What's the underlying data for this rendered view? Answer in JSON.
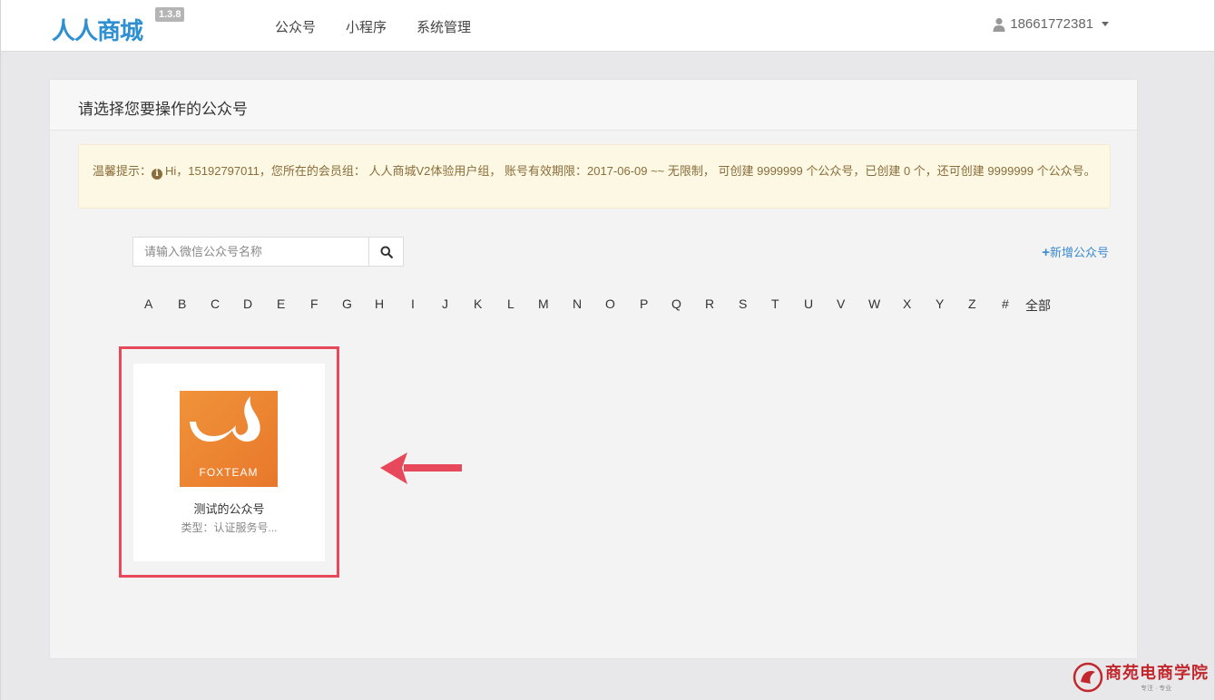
{
  "navbar": {
    "logo_text": "人人商城",
    "version": "1.3.8",
    "items": [
      "公众号",
      "小程序",
      "系统管理"
    ],
    "user": "18661772381"
  },
  "panel": {
    "title": "请选择您要操作的公众号",
    "alert_prefix": "温馨提示：",
    "alert_text": "Hi，15192797011，您所在的会员组： 人人商城V2体验用户组， 账号有效期限：2017-06-09 ~~ 无限制， 可创建 9999999 个公众号，已创建 0 个，还可创建 9999999 个公众号。"
  },
  "search": {
    "placeholder": "请输入微信公众号名称"
  },
  "add_account": "新增公众号",
  "letters": [
    "A",
    "B",
    "C",
    "D",
    "E",
    "F",
    "G",
    "H",
    "I",
    "J",
    "K",
    "L",
    "M",
    "N",
    "O",
    "P",
    "Q",
    "R",
    "S",
    "T",
    "U",
    "V",
    "W",
    "X",
    "Y",
    "Z",
    "#",
    "全部"
  ],
  "account": {
    "logo_brand": "FOXTEAM",
    "name": "测试的公众号",
    "type": "类型：认证服务号..."
  },
  "watermark": {
    "title": "商苑电商学院",
    "subtitle": "专注 · 专业"
  },
  "colors": {
    "accent": "#3a8ad0",
    "highlight": "#e8495a",
    "logo_orange": "#ee8a35"
  }
}
